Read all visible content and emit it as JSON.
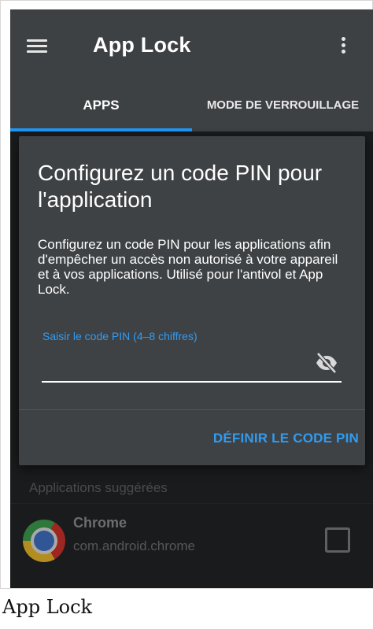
{
  "app_bar": {
    "title": "App Lock",
    "menu_icon": "hamburger-menu-icon",
    "overflow_icon": "more-vert-icon"
  },
  "tabs": [
    {
      "label": "APPS",
      "selected": true
    },
    {
      "label": "MODE DE VERROUILLAGE",
      "selected": false
    }
  ],
  "dialog": {
    "title": "Configurez un code PIN pour l'application",
    "message": "Configurez un code PIN pour les applications afin d'empêcher un accès non autorisé à votre appareil et à vos applications. Utilisé pour l'antivol et App Lock.",
    "pin_field": {
      "label": "Saisir le code PIN (4–8 chiffres)",
      "value": "",
      "toggle_icon": "eye-off-icon"
    },
    "action_label": "DÉFINIR LE CODE PIN"
  },
  "suggested": {
    "header": "Applications suggérées",
    "apps": [
      {
        "name": "Chrome",
        "package": "com.android.chrome",
        "icon": "chrome-logo",
        "checked": false
      }
    ]
  },
  "caption": "App Lock",
  "colors": {
    "accent": "#2196f3",
    "app_bar": "#3e4144",
    "background": "#212325",
    "dialog": "#3f4245"
  }
}
